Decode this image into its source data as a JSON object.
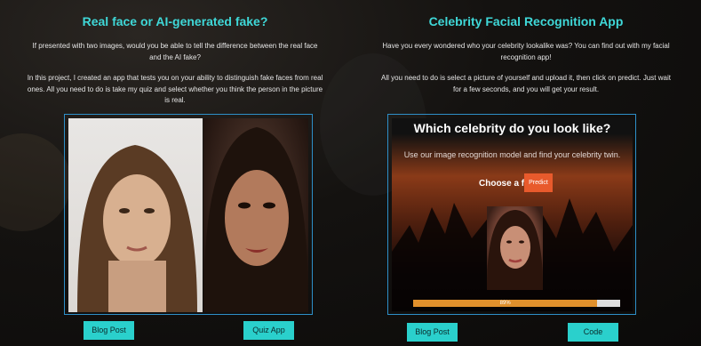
{
  "projects": [
    {
      "title": "Real face or AI-generated fake?",
      "desc1": "If presented with two images, would you be able to tell the difference between the real face and the AI fake?",
      "desc2": "In this project, I created an app that tests you on your ability to distinguish fake faces from real ones. All you need to do is take my quiz and select whether you think the person in the picture is real.",
      "buttons": [
        "Blog Post",
        "Quiz App"
      ]
    },
    {
      "title": "Celebrity Facial Recognition App",
      "desc1": "Have you every wondered who your celebrity lookalike was? You can find out with my facial recognition app!",
      "desc2": "All you need to do is select a picture of yourself and upload it, then click on predict. Just wait for a few seconds, and you will get your result.",
      "buttons": [
        "Blog Post",
        "Code"
      ],
      "app": {
        "title": "Which celebrity do you look like?",
        "subtitle": "Use our image recognition model and find your celebrity twin.",
        "choose_label": "Choose a file",
        "predict_label": "Predict",
        "progress_label": "89%",
        "progress": 0.89
      }
    }
  ],
  "colors": {
    "accent": "#2ad0cc",
    "title": "#3fd8d8",
    "frame": "#2e8fc8",
    "progress": "#e0902c"
  }
}
